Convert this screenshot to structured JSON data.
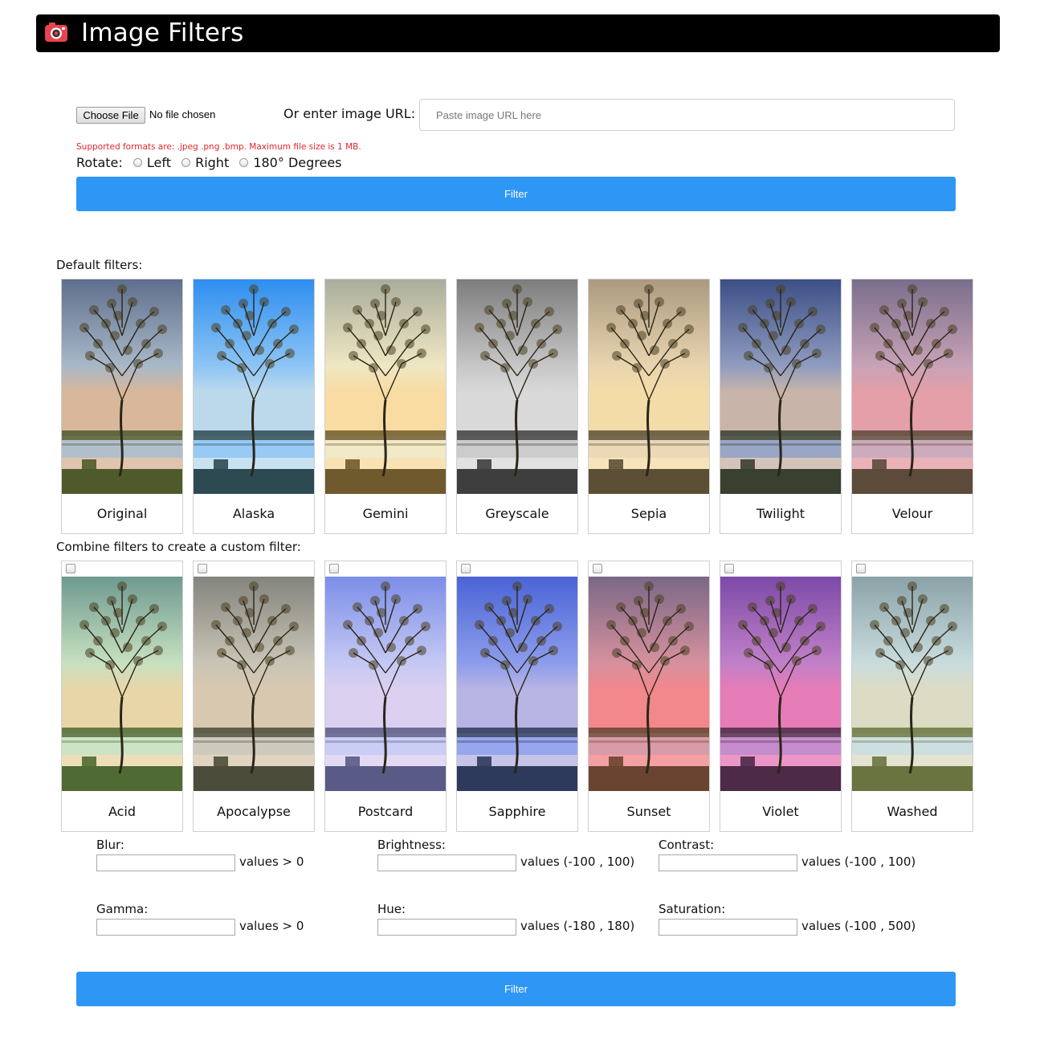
{
  "header": {
    "title": "Image Filters"
  },
  "upload": {
    "choose_label": "Choose File",
    "no_file": "No file chosen",
    "url_label": "Or enter image URL:",
    "url_placeholder": "Paste image URL here",
    "url_value": "",
    "formats_note": "Supported formats are: .jpeg .png .bmp. Maximum file size is 1 MB."
  },
  "rotate": {
    "label": "Rotate:",
    "options": [
      "Left",
      "Right",
      "180° Degrees"
    ]
  },
  "filter_button_label": "Filter",
  "default_filters": {
    "label": "Default filters:",
    "items": [
      {
        "name": "Original",
        "sky": "#5e6f8c",
        "sky2": "#a8b8c8",
        "warm": "#d8b79a",
        "ground": "#4f5a2c"
      },
      {
        "name": "Alaska",
        "sky": "#2e8ef0",
        "sky2": "#8cc4f4",
        "warm": "#bcd9ec",
        "ground": "#2d4a52"
      },
      {
        "name": "Gemini",
        "sky": "#a9ad9c",
        "sky2": "#efe7c2",
        "warm": "#f8dca2",
        "ground": "#6e5a2c"
      },
      {
        "name": "Greyscale",
        "sky": "#7d7d7d",
        "sky2": "#c6c6c6",
        "warm": "#d9d9d9",
        "ground": "#3e3e3e"
      },
      {
        "name": "Sepia",
        "sky": "#ac9a80",
        "sky2": "#e8d4ae",
        "warm": "#f4dca8",
        "ground": "#5c4f36"
      },
      {
        "name": "Twilight",
        "sky": "#3c4f86",
        "sky2": "#8f9cc0",
        "warm": "#c8b4a8",
        "ground": "#3a4030"
      },
      {
        "name": "Velour",
        "sky": "#7a6e8c",
        "sky2": "#c7a2b6",
        "warm": "#e49fa8",
        "ground": "#5c4a3a"
      }
    ]
  },
  "custom_filters": {
    "label": "Combine filters to create a custom filter:",
    "items": [
      {
        "name": "Acid",
        "sky": "#6e9a90",
        "sky2": "#c6e0c0",
        "warm": "#e8d6a8",
        "ground": "#4f6a32"
      },
      {
        "name": "Apocalypse",
        "sky": "#84847e",
        "sky2": "#c8c4b6",
        "warm": "#d8c8b0",
        "ground": "#4c4c3a"
      },
      {
        "name": "Postcard",
        "sky": "#7c8ee8",
        "sky2": "#c4c8f4",
        "warm": "#dcd0f0",
        "ground": "#5a5a86"
      },
      {
        "name": "Sapphire",
        "sky": "#4a64d6",
        "sky2": "#8c9cec",
        "warm": "#b8b4e4",
        "ground": "#2e3a5c"
      },
      {
        "name": "Sunset",
        "sky": "#7a6886",
        "sky2": "#d6909e",
        "warm": "#f2878c",
        "ground": "#6a4430"
      },
      {
        "name": "Violet",
        "sky": "#7c4aa8",
        "sky2": "#c080c8",
        "warm": "#e67cb8",
        "ground": "#4c2a48"
      },
      {
        "name": "Washed",
        "sky": "#8aa2a8",
        "sky2": "#c8dcde",
        "warm": "#dcdcc4",
        "ground": "#6a7440"
      }
    ]
  },
  "params": [
    {
      "label": "Blur:",
      "range": "values > 0"
    },
    {
      "label": "Brightness:",
      "range": "values (-100 , 100)"
    },
    {
      "label": "Contrast:",
      "range": "values (-100 , 100)"
    },
    {
      "label": "Gamma:",
      "range": "values > 0"
    },
    {
      "label": "Hue:",
      "range": "values (-180 , 180)"
    },
    {
      "label": "Saturation:",
      "range": "values (-100 , 500)"
    }
  ],
  "colors": {
    "accent": "#2e96f5",
    "header_bg": "#000000",
    "note_red": "#e0262e"
  }
}
